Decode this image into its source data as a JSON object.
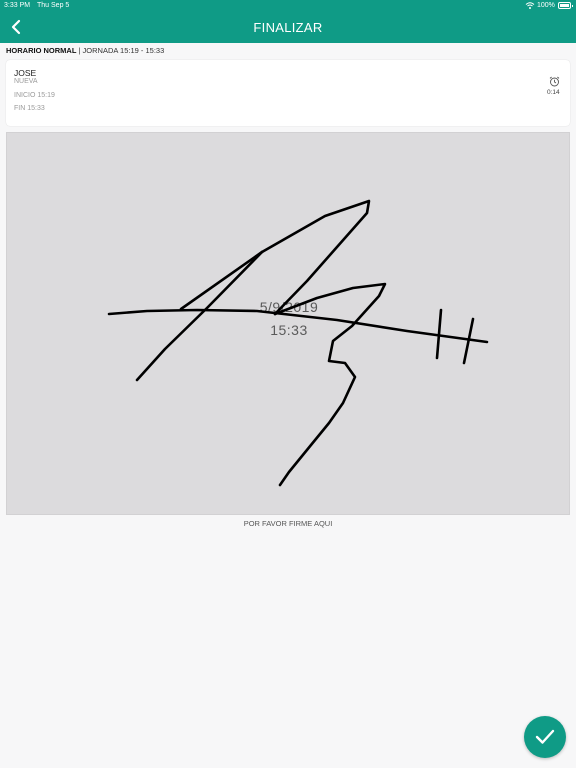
{
  "status_bar": {
    "time": "3:33 PM",
    "date": "Thu Sep 5",
    "battery": "100%"
  },
  "header": {
    "title": "FINALIZAR",
    "back_icon": "chevron-left-icon"
  },
  "shift": {
    "label": "HORARIO NORMAL",
    "separator": " | ",
    "detail": "JORNADA 15:19 - 15:33"
  },
  "card": {
    "name": "JOSE",
    "status": "NUEVA",
    "start": "INICIO 15:19",
    "end": "FIN 15:33",
    "duration": "0:14",
    "icon": "alarm-clock-icon"
  },
  "signature": {
    "date_stamp": "5/9/2019",
    "time_stamp": "15:33",
    "hint": "POR FAVOR FIRME AQUI"
  },
  "fab": {
    "icon": "checkmark-icon"
  },
  "colors": {
    "primary": "#0f9b86",
    "pad_background": "#dcdbdd",
    "ink": "#000000"
  }
}
